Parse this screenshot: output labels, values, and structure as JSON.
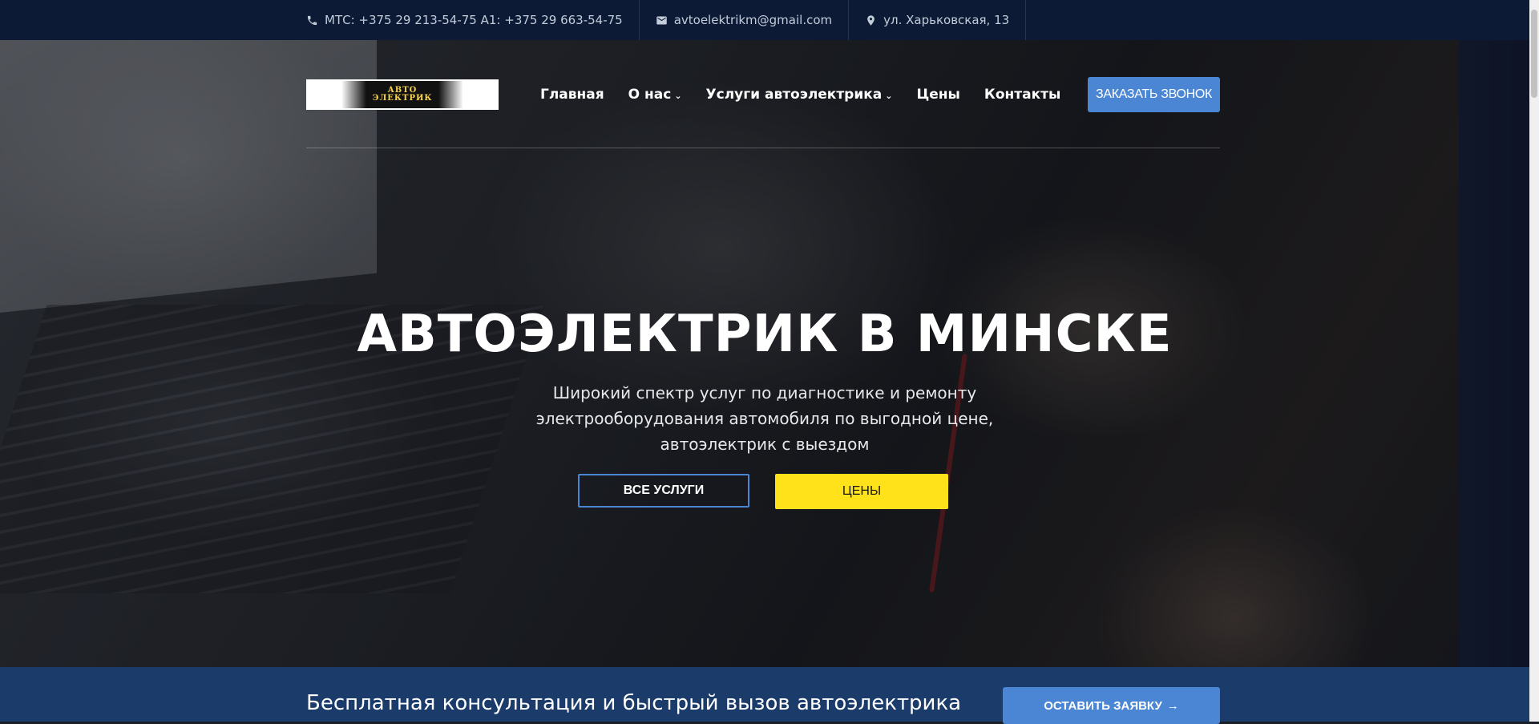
{
  "topbar": {
    "phone": "МТС: +375 29 213-54-75 А1: +375 29 663-54-75",
    "email": "avtoelektrikm@gmail.com",
    "address": "ул. Харьковская, 13"
  },
  "logo": {
    "text_line1": "АВТО",
    "text_line2": "ЭЛЕКТРИК"
  },
  "nav": {
    "items": [
      {
        "label": "Главная",
        "dropdown": false
      },
      {
        "label": "О нас",
        "dropdown": true
      },
      {
        "label": "Услуги автоэлектрика",
        "dropdown": true
      },
      {
        "label": "Цены",
        "dropdown": false
      },
      {
        "label": "Контакты",
        "dropdown": false
      }
    ],
    "cta_label": "ЗАКАЗАТЬ ЗВОНОК"
  },
  "hero": {
    "title": "АВТОЭЛЕКТРИК В МИНСКЕ",
    "subtitle": "Широкий спектр услуг по диагностике и ремонту электрооборудования автомобиля по выгодной цене, автоэлектрик с выездом",
    "btn_services": "ВСЕ УСЛУГИ",
    "btn_prices": "ЦЕНЫ"
  },
  "band": {
    "text": "Бесплатная консультация и быстрый вызов автоэлектрика",
    "button": "ОСТАВИТЬ ЗАЯВКУ"
  },
  "colors": {
    "topbar_bg": "#0c1a36",
    "accent_blue": "#4a86d4",
    "accent_yellow": "#ffe21a",
    "band_bg": "#1b3b6b"
  }
}
